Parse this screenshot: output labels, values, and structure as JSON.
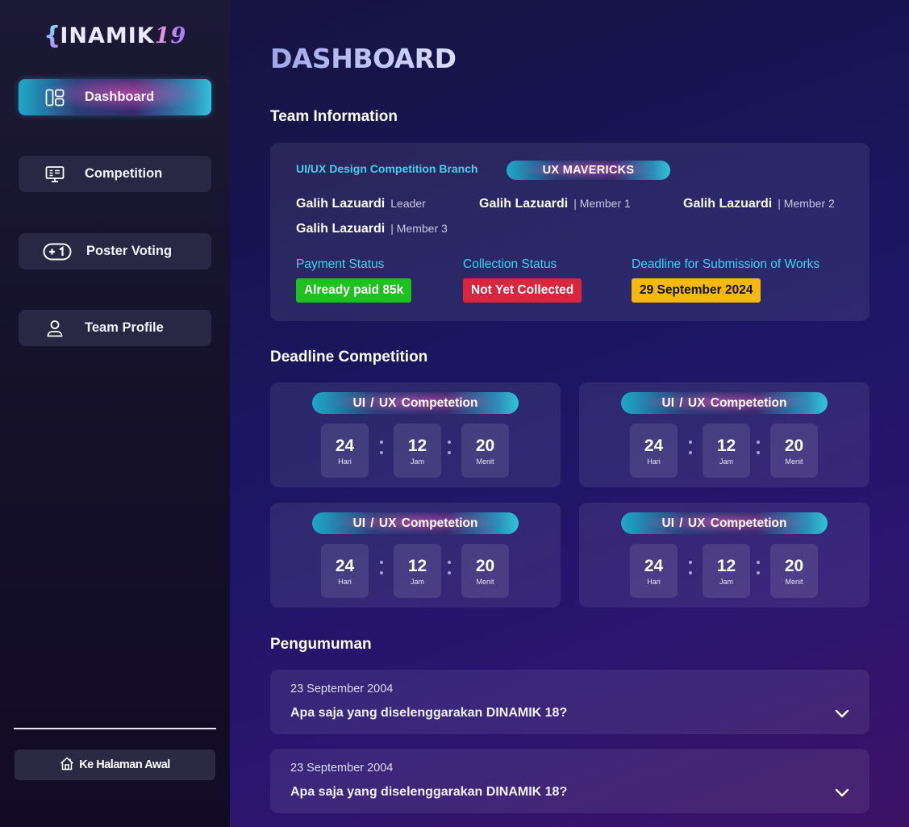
{
  "logo": {
    "brace": "{",
    "text": "INAMIK",
    "num": "19"
  },
  "sidebar": {
    "items": [
      {
        "label": "Dashboard",
        "icon": "layout-icon",
        "active": true
      },
      {
        "label": "Competition",
        "icon": "monitor-icon",
        "active": false
      },
      {
        "label": "Poster Voting",
        "icon": "plus-one-icon",
        "active": false
      },
      {
        "label": "Team Profile",
        "icon": "user-icon",
        "active": false
      }
    ],
    "home_label": "Ke Halaman Awal"
  },
  "main": {
    "title": "DASHBOARD",
    "team_section_title": "Team Information",
    "team": {
      "branch": "UI/UX Design Competition Branch",
      "name": "UX MAVERICKS",
      "members": [
        {
          "name": "Galih Lazuardi",
          "role": "Leader"
        },
        {
          "name": "Galih Lazuardi",
          "role": "| Member 1"
        },
        {
          "name": "Galih Lazuardi",
          "role": "| Member 2"
        },
        {
          "name": "Galih Lazuardi",
          "role": "| Member 3"
        }
      ],
      "payment_label": "Payment Status",
      "payment_value": "Already paid 85k",
      "collection_label": "Collection Status",
      "collection_value": "Not Yet Collected",
      "deadline_label": "Deadline for Submission of Works",
      "deadline_value": "29 September 2024"
    },
    "deadline_section_title": "Deadline Competition",
    "countdowns": [
      {
        "title": "UI / UX  Competetion",
        "days": "24",
        "days_unit": "Hari",
        "hours": "12",
        "hours_unit": "Jam",
        "minutes": "20",
        "minutes_unit": "Menit"
      },
      {
        "title": "UI / UX  Competetion",
        "days": "24",
        "days_unit": "Hari",
        "hours": "12",
        "hours_unit": "Jam",
        "minutes": "20",
        "minutes_unit": "Menit"
      },
      {
        "title": "UI / UX  Competetion",
        "days": "24",
        "days_unit": "Hari",
        "hours": "12",
        "hours_unit": "Jam",
        "minutes": "20",
        "minutes_unit": "Menit"
      },
      {
        "title": "UI / UX  Competetion",
        "days": "24",
        "days_unit": "Hari",
        "hours": "12",
        "hours_unit": "Jam",
        "minutes": "20",
        "minutes_unit": "Menit"
      }
    ],
    "announcement_section_title": "Pengumuman",
    "announcements": [
      {
        "date": "23 September 2004",
        "question": "Apa saja yang diselenggarakan DINAMIK 18?"
      },
      {
        "date": "23 September 2004",
        "question": "Apa saja yang diselenggarakan DINAMIK 18?"
      }
    ]
  },
  "colors": {
    "accent_cyan": "#3fd2ee",
    "paid_green": "#1ec21e",
    "not_collected_red": "#d7263d",
    "deadline_yellow": "#f5b80f"
  }
}
